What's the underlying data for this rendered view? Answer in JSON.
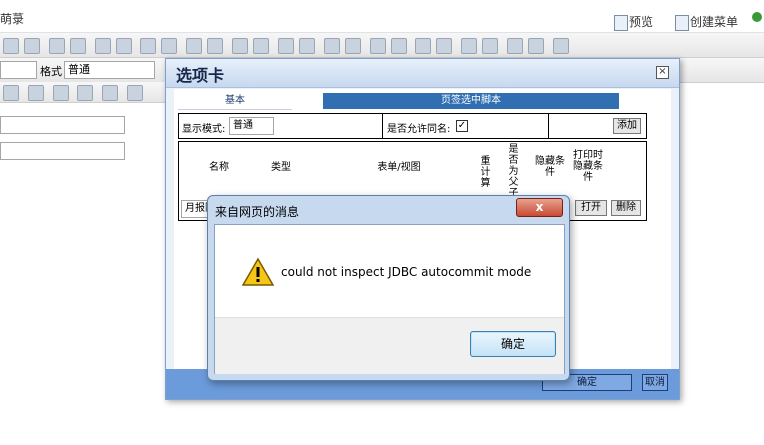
{
  "header": {
    "title_fragment": "萌菉",
    "preview": "预览",
    "create_menu": "创建菜单"
  },
  "toolbar": {
    "format_label": "格式",
    "format_select_value": "普通",
    "style_select_value": ""
  },
  "dialog": {
    "title": "选项卡",
    "tabs": [
      "基本",
      "页签选中脚本"
    ],
    "display_mode_label": "显示模式:",
    "display_mode_value": "普通",
    "allow_same_name_label": "是否允许同名:",
    "allow_same_name_checked": "✓",
    "add_button": "添加",
    "columns": [
      "名称",
      "类型",
      "表单/视图",
      "重计算",
      "是否为父子关系",
      "隐藏条件",
      "打印时隐藏条件"
    ],
    "row_name_value": "月报附件",
    "row_open_button": "打开",
    "row_delete_button": "删除",
    "footer_ok": "确定",
    "footer_cancel": "取消"
  },
  "alert": {
    "title": "来自网页的消息",
    "message": "could not inspect JDBC autocommit mode",
    "ok_button": "确定",
    "close_glyph": "x"
  },
  "colors": {
    "dialog_footer": "#6c9bdb",
    "script_tab": "#2f6fb2",
    "alert_frame": "#c6d9ef",
    "close_red": "#c84a32"
  }
}
